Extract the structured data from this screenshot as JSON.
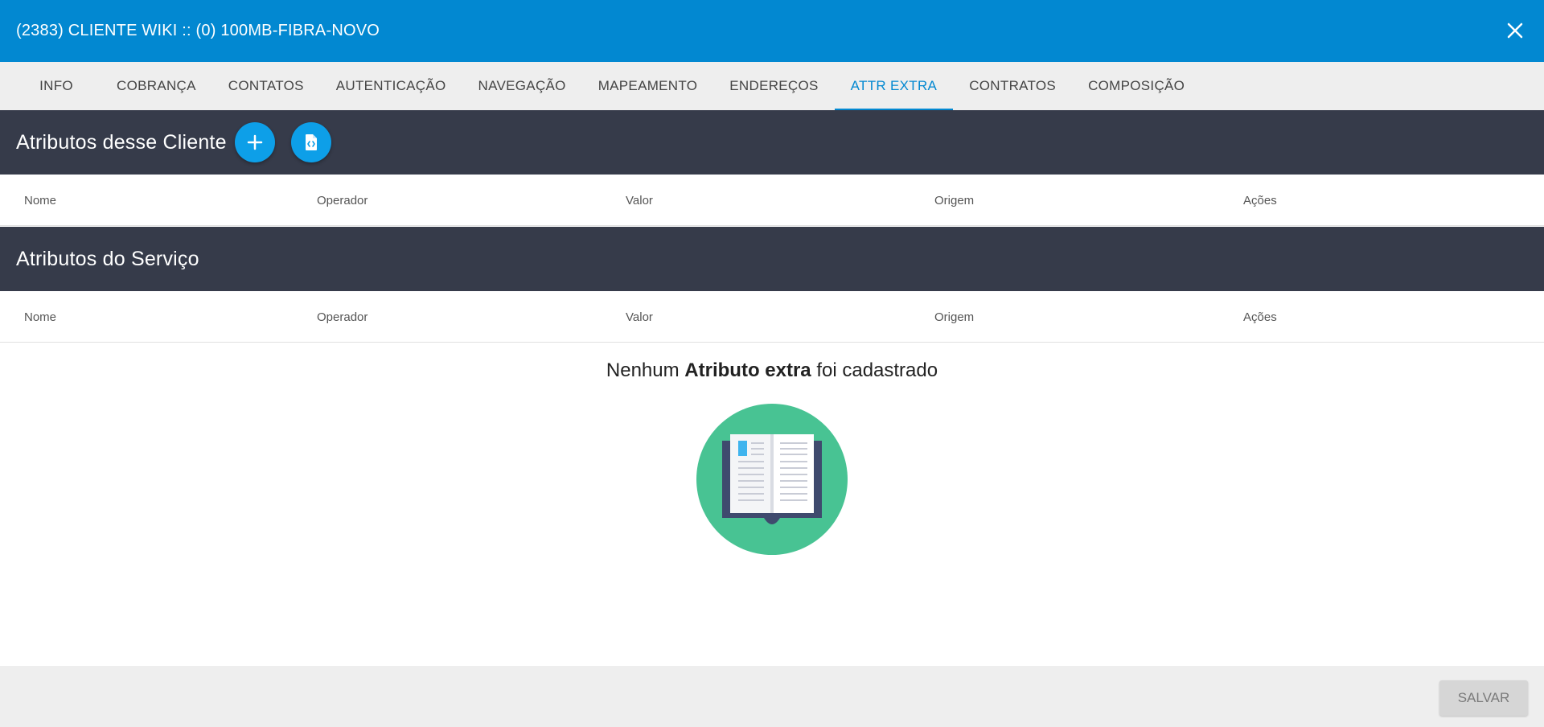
{
  "header": {
    "title": "(2383) CLIENTE WIKI :: (0) 100MB-FIBRA-NOVO",
    "close_icon": "close-icon"
  },
  "tabs": [
    {
      "label": "INFO",
      "active": false
    },
    {
      "label": "COBRANÇA",
      "active": false
    },
    {
      "label": "CONTATOS",
      "active": false
    },
    {
      "label": "AUTENTICAÇÃO",
      "active": false
    },
    {
      "label": "NAVEGAÇÃO",
      "active": false
    },
    {
      "label": "MAPEAMENTO",
      "active": false
    },
    {
      "label": "ENDEREÇOS",
      "active": false
    },
    {
      "label": "ATTR EXTRA",
      "active": true
    },
    {
      "label": "CONTRATOS",
      "active": false
    },
    {
      "label": "COMPOSIÇÃO",
      "active": false
    }
  ],
  "client_section": {
    "title": "Atributos desse Cliente",
    "add_icon": "plus-icon",
    "code_file_icon": "code-file-icon",
    "columns": [
      "Nome",
      "Operador",
      "Valor",
      "Origem",
      "Ações"
    ]
  },
  "service_section": {
    "title": "Atributos do Serviço",
    "columns": [
      "Nome",
      "Operador",
      "Valor",
      "Origem",
      "Ações"
    ]
  },
  "empty_state": {
    "prefix": "Nenhum ",
    "bold": "Atributo extra",
    "suffix": " foi cadastrado",
    "icon": "open-book-icon"
  },
  "footer": {
    "save_label": "SALVAR"
  },
  "colors": {
    "primary": "#0288d1",
    "section_bar": "#363b4a",
    "round_button": "#0d9fe8",
    "illustration_circle": "#48c393"
  }
}
